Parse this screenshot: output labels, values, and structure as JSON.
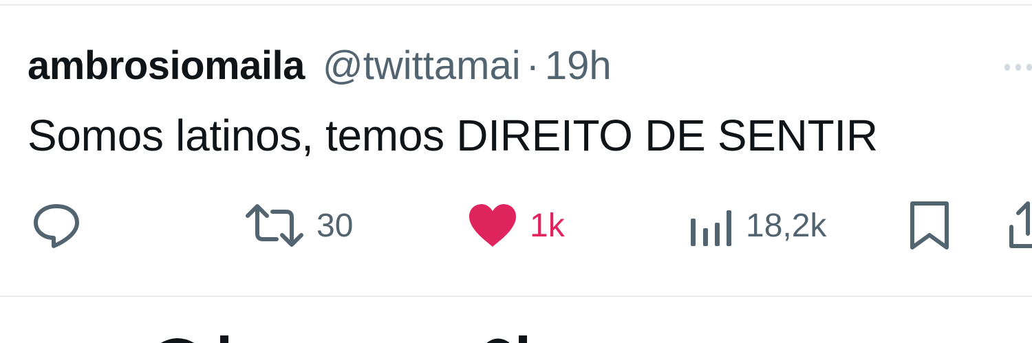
{
  "tweet": {
    "display_name": "ambrosiomaila",
    "handle": "@twittamai",
    "separator": "·",
    "time": "19h",
    "text": "Somos latinos, temos DIREITO DE SENTIR"
  },
  "actions": {
    "reply": {
      "icon": "reply-icon",
      "count": ""
    },
    "retweet": {
      "icon": "retweet-icon",
      "count": "30"
    },
    "like": {
      "icon": "heart-icon",
      "count": "1k",
      "liked": true
    },
    "views": {
      "icon": "views-icon",
      "count": "18,2k"
    },
    "bookmark": {
      "icon": "bookmark-icon"
    },
    "share": {
      "icon": "share-icon"
    }
  },
  "colors": {
    "text_primary": "#0f1419",
    "text_secondary": "#536471",
    "like_active": "#e0245e",
    "divider": "#e7e9ea"
  }
}
